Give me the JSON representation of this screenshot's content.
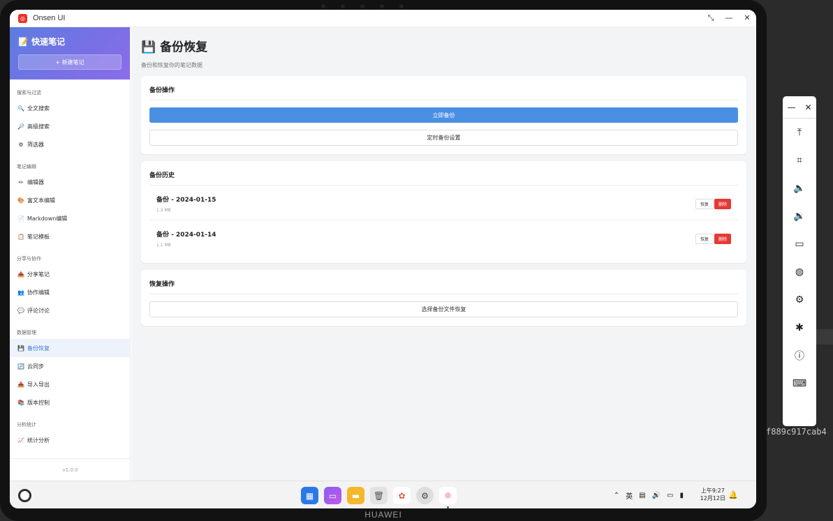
{
  "window": {
    "title": "Onsen UI",
    "logo_text": "ON"
  },
  "device": {
    "brand": "HUAWEI"
  },
  "sidebar": {
    "title": "📝 快速笔记",
    "new_button": "+ 新建笔记",
    "sections": [
      {
        "label": "搜索与过滤",
        "items": [
          {
            "icon": "🔍",
            "label": "全文搜索"
          },
          {
            "icon": "🔎",
            "label": "高级搜索"
          },
          {
            "icon": "⚙",
            "label": "筛选器"
          }
        ]
      },
      {
        "label": "笔记编辑",
        "items": [
          {
            "icon": "✏",
            "label": "编辑器"
          },
          {
            "icon": "🎨",
            "label": "富文本编辑"
          },
          {
            "icon": "📄",
            "label": "Markdown编辑"
          },
          {
            "icon": "📋",
            "label": "笔记模板"
          }
        ]
      },
      {
        "label": "分享与协作",
        "items": [
          {
            "icon": "📤",
            "label": "分享笔记"
          },
          {
            "icon": "👥",
            "label": "协作编辑"
          },
          {
            "icon": "💬",
            "label": "评论讨论"
          }
        ]
      },
      {
        "label": "数据管理",
        "items": [
          {
            "icon": "💾",
            "label": "备份恢复",
            "active": true
          },
          {
            "icon": "🔄",
            "label": "云同步"
          },
          {
            "icon": "📤",
            "label": "导入导出"
          },
          {
            "icon": "📚",
            "label": "版本控制"
          }
        ]
      },
      {
        "label": "分析统计",
        "items": [
          {
            "icon": "📈",
            "label": "统计分析"
          }
        ]
      }
    ],
    "version": "v1.0.0"
  },
  "main": {
    "title": "💾 备份恢复",
    "subtitle": "备份和恢复你的笔记数据",
    "backup_ops": {
      "title": "备份操作",
      "backup_now": "立即备份",
      "schedule": "定时备份设置"
    },
    "history": {
      "title": "备份历史",
      "rows": [
        {
          "name": "备份 - 2024-01-15",
          "size": "1.2 MB",
          "restore": "恢复",
          "delete": "删除"
        },
        {
          "name": "备份 - 2024-01-14",
          "size": "1.1 MB",
          "restore": "恢复",
          "delete": "删除"
        }
      ]
    },
    "restore_ops": {
      "title": "恢复操作",
      "choose_file": "选择备份文件恢复"
    }
  },
  "taskbar": {
    "time": "上午9:27",
    "date": "12月12日",
    "ime": "英",
    "dock_icons": [
      "app-grid-icon",
      "multitask-icon",
      "notes-icon",
      "trash-icon",
      "photos-icon",
      "settings-icon",
      "onsen-app-icon"
    ]
  },
  "tool_panel": {
    "icons": [
      "pin-top-icon",
      "crop-icon",
      "volume-up-icon",
      "volume-down-icon",
      "battery-icon",
      "globe-icon",
      "settings-icon",
      "bug-icon",
      "info-icon",
      "keyboard-icon"
    ]
  },
  "side_text": "f889c917cab4"
}
